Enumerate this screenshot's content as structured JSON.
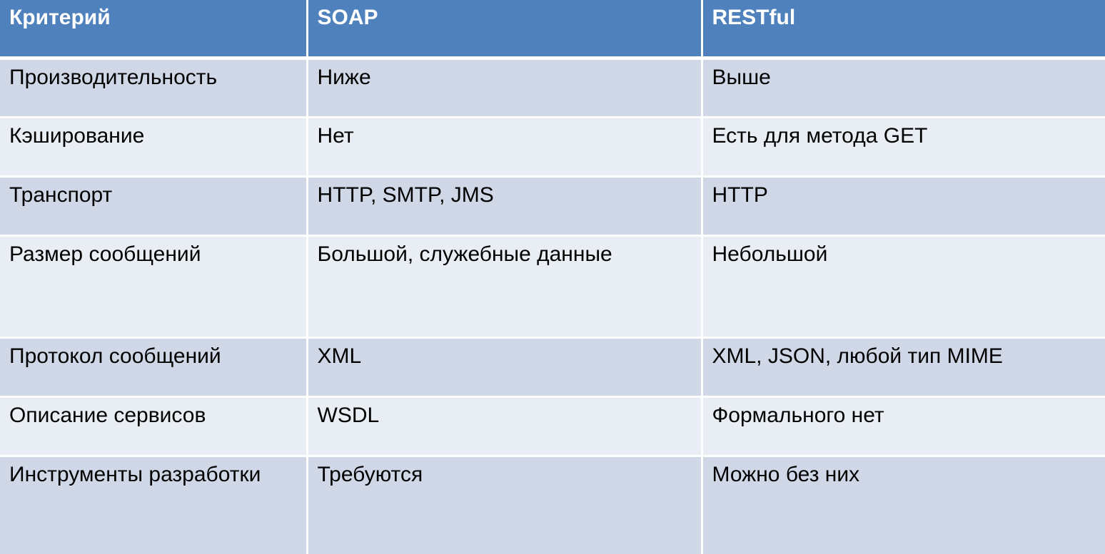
{
  "table": {
    "headers": [
      "Критерий",
      "SOAP",
      "RESTful"
    ],
    "rows": [
      [
        "Производительность",
        "Ниже",
        "Выше"
      ],
      [
        "Кэширование",
        "Нет",
        "Есть для метода GET"
      ],
      [
        "Транспорт",
        "HTTP, SMTP, JMS",
        "HTTP"
      ],
      [
        "Размер сообщений",
        "Большой, служебные данные",
        "Небольшой"
      ],
      [
        "Протокол сообщений",
        "XML",
        "XML, JSON, любой тип MIME"
      ],
      [
        "Описание сервисов",
        "WSDL",
        "Формального нет"
      ],
      [
        "Инструменты разработки",
        "Требуются",
        "Можно без них"
      ]
    ]
  },
  "colors": {
    "header_bg": "#4f81bd",
    "row_odd_bg": "#d0d8e8",
    "row_even_bg": "#e9edf4",
    "header_text": "#ffffff",
    "body_text": "#000000"
  }
}
